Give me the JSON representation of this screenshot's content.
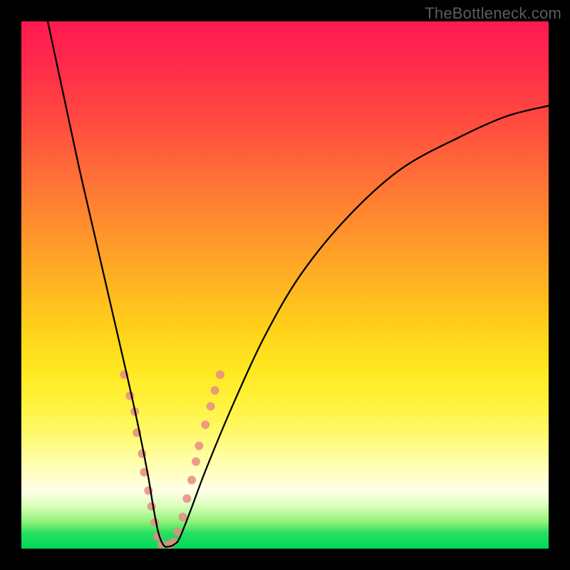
{
  "watermark": {
    "text": "TheBottleneck.com"
  },
  "chart_data": {
    "type": "line",
    "title": "",
    "xlabel": "",
    "ylabel": "",
    "xlim": [
      0,
      100
    ],
    "ylim": [
      0,
      100
    ],
    "grid": false,
    "legend": false,
    "description": "V-shaped bottleneck curve over vertical rainbow heatmap (red=high, green=low). Minimum of the curve sits near x≈27, y≈0. Axes are unlabeled.",
    "series": [
      {
        "name": "bottleneck-curve",
        "color": "#000000",
        "x": [
          5,
          8,
          11,
          14,
          17,
          20,
          22,
          24,
          25,
          26,
          27,
          28,
          29,
          30,
          32,
          35,
          40,
          46,
          53,
          62,
          72,
          83,
          92,
          100
        ],
        "y": [
          100,
          86,
          72,
          59,
          46,
          33,
          24,
          14,
          8,
          3,
          0.6,
          0.4,
          0.8,
          2,
          7,
          15,
          27,
          40,
          52,
          63,
          72,
          78,
          82,
          84
        ]
      }
    ],
    "highlight_points": {
      "name": "sample-dots",
      "color": "#e98b84",
      "radius_px": 6,
      "points": [
        {
          "x": 19.5,
          "y": 33
        },
        {
          "x": 20.6,
          "y": 29
        },
        {
          "x": 21.5,
          "y": 26
        },
        {
          "x": 21.9,
          "y": 22
        },
        {
          "x": 22.9,
          "y": 18
        },
        {
          "x": 23.3,
          "y": 14.5
        },
        {
          "x": 24.1,
          "y": 11
        },
        {
          "x": 24.7,
          "y": 8
        },
        {
          "x": 25.3,
          "y": 5
        },
        {
          "x": 25.8,
          "y": 2.3
        },
        {
          "x": 26.6,
          "y": 0.8
        },
        {
          "x": 28.1,
          "y": 0.8
        },
        {
          "x": 28.9,
          "y": 1.3
        },
        {
          "x": 29.7,
          "y": 3.2
        },
        {
          "x": 30.6,
          "y": 6.0
        },
        {
          "x": 31.4,
          "y": 9.5
        },
        {
          "x": 32.3,
          "y": 13
        },
        {
          "x": 33.1,
          "y": 16.5
        },
        {
          "x": 33.7,
          "y": 19.5
        },
        {
          "x": 34.9,
          "y": 23.5
        },
        {
          "x": 35.9,
          "y": 27
        },
        {
          "x": 36.7,
          "y": 30
        },
        {
          "x": 37.7,
          "y": 33
        }
      ]
    },
    "heatmap_bands": [
      {
        "y": 100,
        "color": "#ff1a52"
      },
      {
        "y": 80,
        "color": "#ff6a38"
      },
      {
        "y": 60,
        "color": "#ffae24"
      },
      {
        "y": 40,
        "color": "#ffe820"
      },
      {
        "y": 20,
        "color": "#fff96a"
      },
      {
        "y": 10,
        "color": "#ffffe0"
      },
      {
        "y": 3,
        "color": "#28e060"
      },
      {
        "y": 0,
        "color": "#00d858"
      }
    ]
  }
}
